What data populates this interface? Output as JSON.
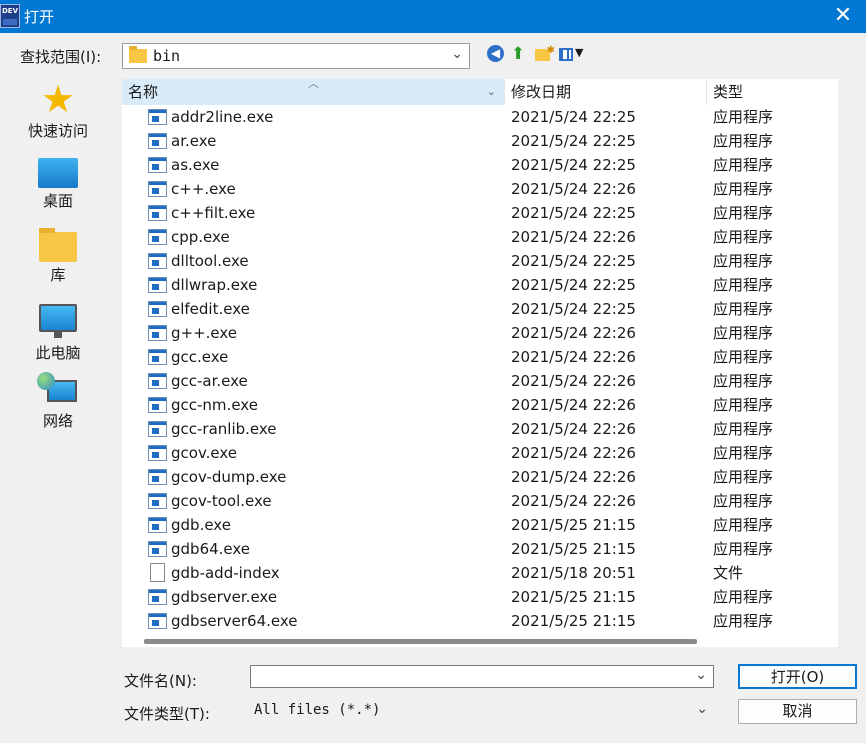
{
  "window": {
    "title": "打开",
    "app_icon_text": "DEV",
    "close_symbol": "✕"
  },
  "lookin": {
    "label": "查找范围(I):",
    "value": "bin"
  },
  "places": [
    {
      "label": "快速访问",
      "icon": "star-icon"
    },
    {
      "label": "桌面",
      "icon": "desktop-icon"
    },
    {
      "label": "库",
      "icon": "library-icon"
    },
    {
      "label": "此电脑",
      "icon": "computer-icon"
    },
    {
      "label": "网络",
      "icon": "network-icon"
    }
  ],
  "columns": {
    "name": "名称",
    "date": "修改日期",
    "type": "类型"
  },
  "files": [
    {
      "name": "addr2line.exe",
      "date": "2021/5/24 22:25",
      "type": "应用程序",
      "icon": "exe"
    },
    {
      "name": "ar.exe",
      "date": "2021/5/24 22:25",
      "type": "应用程序",
      "icon": "exe"
    },
    {
      "name": "as.exe",
      "date": "2021/5/24 22:25",
      "type": "应用程序",
      "icon": "exe"
    },
    {
      "name": "c++.exe",
      "date": "2021/5/24 22:26",
      "type": "应用程序",
      "icon": "exe"
    },
    {
      "name": "c++filt.exe",
      "date": "2021/5/24 22:25",
      "type": "应用程序",
      "icon": "exe"
    },
    {
      "name": "cpp.exe",
      "date": "2021/5/24 22:26",
      "type": "应用程序",
      "icon": "exe"
    },
    {
      "name": "dlltool.exe",
      "date": "2021/5/24 22:25",
      "type": "应用程序",
      "icon": "exe"
    },
    {
      "name": "dllwrap.exe",
      "date": "2021/5/24 22:25",
      "type": "应用程序",
      "icon": "exe"
    },
    {
      "name": "elfedit.exe",
      "date": "2021/5/24 22:25",
      "type": "应用程序",
      "icon": "exe"
    },
    {
      "name": "g++.exe",
      "date": "2021/5/24 22:26",
      "type": "应用程序",
      "icon": "exe"
    },
    {
      "name": "gcc.exe",
      "date": "2021/5/24 22:26",
      "type": "应用程序",
      "icon": "exe"
    },
    {
      "name": "gcc-ar.exe",
      "date": "2021/5/24 22:26",
      "type": "应用程序",
      "icon": "exe"
    },
    {
      "name": "gcc-nm.exe",
      "date": "2021/5/24 22:26",
      "type": "应用程序",
      "icon": "exe"
    },
    {
      "name": "gcc-ranlib.exe",
      "date": "2021/5/24 22:26",
      "type": "应用程序",
      "icon": "exe"
    },
    {
      "name": "gcov.exe",
      "date": "2021/5/24 22:26",
      "type": "应用程序",
      "icon": "exe"
    },
    {
      "name": "gcov-dump.exe",
      "date": "2021/5/24 22:26",
      "type": "应用程序",
      "icon": "exe"
    },
    {
      "name": "gcov-tool.exe",
      "date": "2021/5/24 22:26",
      "type": "应用程序",
      "icon": "exe"
    },
    {
      "name": "gdb.exe",
      "date": "2021/5/25 21:15",
      "type": "应用程序",
      "icon": "exe"
    },
    {
      "name": "gdb64.exe",
      "date": "2021/5/25 21:15",
      "type": "应用程序",
      "icon": "exe"
    },
    {
      "name": "gdb-add-index",
      "date": "2021/5/18 20:51",
      "type": "文件",
      "icon": "doc"
    },
    {
      "name": "gdbserver.exe",
      "date": "2021/5/25 21:15",
      "type": "应用程序",
      "icon": "exe"
    },
    {
      "name": "gdbserver64.exe",
      "date": "2021/5/25 21:15",
      "type": "应用程序",
      "icon": "exe"
    }
  ],
  "filename": {
    "label": "文件名(N):",
    "value": ""
  },
  "filetype": {
    "label": "文件类型(T):",
    "value": "All files (*.*)"
  },
  "buttons": {
    "open": "打开(O)",
    "cancel": "取消"
  },
  "colors": {
    "titlebar": "#0078d4",
    "header_highlight": "#d9ebf9"
  }
}
